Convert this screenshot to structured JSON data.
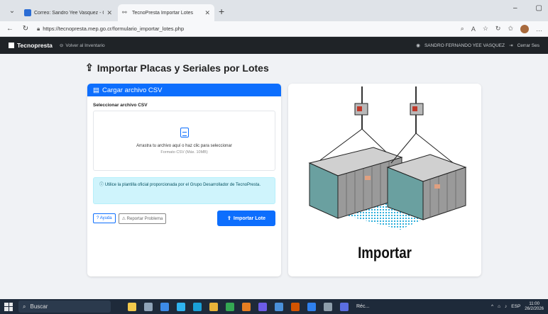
{
  "browser": {
    "tabs": [
      {
        "title": "Correo: Sandro Yee Vasquez - Out"
      },
      {
        "title": "TecnoPresta Importar Lotes"
      }
    ],
    "url": "https://tecnopresta.mep.go.cr/formulario_importar_lotes.php"
  },
  "navbar": {
    "brand": "Tecnopresta",
    "back": "Volver al Inventario",
    "user": "SANDRO FERNANDO YEE VASQUEZ",
    "logout": "Cerrar Ses"
  },
  "page": {
    "title": "Importar Placas y Seriales por Lotes"
  },
  "upload_card": {
    "header": "Cargar archivo CSV",
    "field_label": "Seleccionar archivo CSV",
    "dropzone_text": "Arrastra tu archivo aquí o haz clic para seleccionar",
    "dropzone_sub": "Formato CSV (Máx. 10MB)",
    "info": "Utilice la plantilla oficial proporcionada por el Grupo Desarrollador de TecnoPresta.",
    "help_button": "Ayuda",
    "report_button": "Reportar Problema",
    "import_button": "Importar Lote"
  },
  "image_card": {
    "caption": "Importar"
  },
  "taskbar": {
    "search": "Buscar",
    "running_app": "Réc...",
    "lang": "ESP",
    "time": "11:00",
    "date": "26/2/2026"
  }
}
